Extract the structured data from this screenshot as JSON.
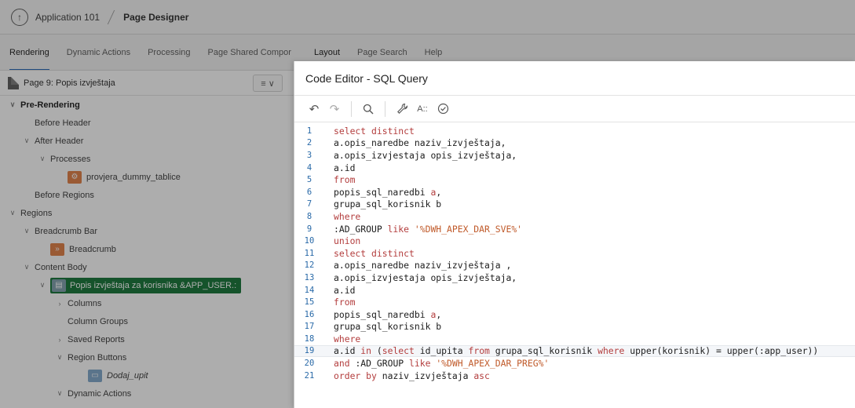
{
  "header": {
    "up_icon": "arrow-up-circle-icon",
    "app_name": "Application 101",
    "current_page": "Page Designer"
  },
  "left_tabs": [
    "Rendering",
    "Dynamic Actions",
    "Processing",
    "Page Shared Compor"
  ],
  "right_tabs": [
    "Layout",
    "Page Search",
    "Help"
  ],
  "tree": {
    "page_title": "Page 9: Popis izvještaja",
    "menu_label": "≡ ∨",
    "nodes": [
      {
        "label": "Pre-Rendering",
        "level": 0,
        "chev": "∨",
        "bold": true
      },
      {
        "label": "Before Header",
        "level": 1,
        "chev": ""
      },
      {
        "label": "After Header",
        "level": 1,
        "chev": "∨"
      },
      {
        "label": "Processes",
        "level": 2,
        "chev": "∨"
      },
      {
        "label": "provjera_dummy_tablice",
        "level": 3,
        "chev": "",
        "icon": "proc"
      },
      {
        "label": "Before Regions",
        "level": 1,
        "chev": ""
      },
      {
        "label": "Regions",
        "level": 0,
        "chev": "∨"
      },
      {
        "label": "Breadcrumb Bar",
        "level": 1,
        "chev": "∨"
      },
      {
        "label": "Breadcrumb",
        "level": 2,
        "chev": "",
        "icon": "bc"
      },
      {
        "label": "Content Body",
        "level": 1,
        "chev": "∨"
      },
      {
        "label": "Popis izvještaja za korisnika &APP_USER.:",
        "level": 2,
        "chev": "∨",
        "icon": "rpt",
        "selected": true
      },
      {
        "label": "Columns",
        "level": 3,
        "chev": "›"
      },
      {
        "label": "Column Groups",
        "level": 3,
        "chev": ""
      },
      {
        "label": "Saved Reports",
        "level": 3,
        "chev": "›"
      },
      {
        "label": "Region Buttons",
        "level": 3,
        "chev": "∨"
      },
      {
        "label": "Dodaj_upit",
        "level": 4,
        "chev": "",
        "icon": "btn",
        "italic": true
      },
      {
        "label": "Dynamic Actions",
        "level": 3,
        "chev": "∨"
      }
    ]
  },
  "dialog": {
    "title": "Code Editor - SQL Query",
    "toolbar": {
      "undo_icon": "undo-icon",
      "redo_icon": "redo-icon",
      "search_icon": "search-icon",
      "wrench_icon": "wrench-icon",
      "autocomplete_label": "A::",
      "validate_icon": "check-circle-icon"
    },
    "highlight_line": 19,
    "lines": [
      {
        "n": "1",
        "parts": [
          {
            "t": "select distinct",
            "c": "kw"
          }
        ]
      },
      {
        "n": "2",
        "parts": [
          {
            "t": "a.opis_naredbe naziv_izvještaja,",
            "c": "id"
          }
        ]
      },
      {
        "n": "3",
        "parts": [
          {
            "t": "a.opis_izvjestaja opis_izvještaja,",
            "c": "id"
          }
        ]
      },
      {
        "n": "4",
        "parts": [
          {
            "t": "a.id",
            "c": "id"
          }
        ]
      },
      {
        "n": "5",
        "parts": [
          {
            "t": "from",
            "c": "kw"
          }
        ]
      },
      {
        "n": "6",
        "parts": [
          {
            "t": "popis_sql_naredbi ",
            "c": "id"
          },
          {
            "t": "a",
            "c": "kw"
          },
          {
            "t": ",",
            "c": "id"
          }
        ]
      },
      {
        "n": "7",
        "parts": [
          {
            "t": "grupa_sql_korisnik b",
            "c": "id"
          }
        ]
      },
      {
        "n": "8",
        "parts": [
          {
            "t": "where",
            "c": "kw"
          }
        ]
      },
      {
        "n": "9",
        "parts": [
          {
            "t": ":AD_GROUP ",
            "c": "bind"
          },
          {
            "t": "like ",
            "c": "kw"
          },
          {
            "t": "'%DWH_APEX_DAR_SVE%'",
            "c": "str"
          }
        ]
      },
      {
        "n": "10",
        "parts": [
          {
            "t": "union",
            "c": "kw"
          }
        ]
      },
      {
        "n": "11",
        "parts": [
          {
            "t": "select distinct",
            "c": "kw"
          }
        ]
      },
      {
        "n": "12",
        "parts": [
          {
            "t": "a.opis_naredbe naziv_izvještaja ,",
            "c": "id"
          }
        ]
      },
      {
        "n": "13",
        "parts": [
          {
            "t": "a.opis_izvjestaja opis_izvještaja,",
            "c": "id"
          }
        ]
      },
      {
        "n": "14",
        "parts": [
          {
            "t": "a.id",
            "c": "id"
          }
        ]
      },
      {
        "n": "15",
        "parts": [
          {
            "t": "from",
            "c": "kw"
          }
        ]
      },
      {
        "n": "16",
        "parts": [
          {
            "t": "popis_sql_naredbi ",
            "c": "id"
          },
          {
            "t": "a",
            "c": "kw"
          },
          {
            "t": ",",
            "c": "id"
          }
        ]
      },
      {
        "n": "17",
        "parts": [
          {
            "t": "grupa_sql_korisnik b",
            "c": "id"
          }
        ]
      },
      {
        "n": "18",
        "parts": [
          {
            "t": "where",
            "c": "kw"
          }
        ]
      },
      {
        "n": "19",
        "parts": [
          {
            "t": "a.id ",
            "c": "id"
          },
          {
            "t": "in ",
            "c": "kw"
          },
          {
            "t": "(",
            "c": "id"
          },
          {
            "t": "select ",
            "c": "kw"
          },
          {
            "t": "id_upita ",
            "c": "id"
          },
          {
            "t": "from ",
            "c": "kw"
          },
          {
            "t": "grupa_sql_korisnik ",
            "c": "id"
          },
          {
            "t": "where ",
            "c": "kw"
          },
          {
            "t": "upper(korisnik) = upper(:app_user))",
            "c": "id"
          }
        ]
      },
      {
        "n": "20",
        "parts": [
          {
            "t": "and ",
            "c": "kw"
          },
          {
            "t": ":AD_GROUP ",
            "c": "bind"
          },
          {
            "t": "like ",
            "c": "kw"
          },
          {
            "t": "'%DWH_APEX_DAR_PREG%'",
            "c": "str"
          }
        ]
      },
      {
        "n": "21",
        "parts": [
          {
            "t": "order by ",
            "c": "kw"
          },
          {
            "t": "naziv_izvještaja ",
            "c": "id"
          },
          {
            "t": "asc",
            "c": "kw"
          }
        ]
      }
    ]
  }
}
